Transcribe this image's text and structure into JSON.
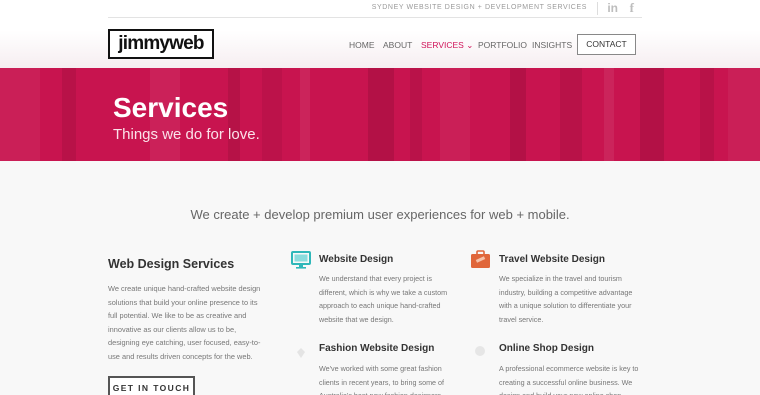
{
  "header": {
    "tagline": "SYDNEY WEBSITE DESIGN + DEVELOPMENT SERVICES",
    "logo_text": "jimmyweb",
    "social": [
      {
        "icon": "linkedin-icon",
        "glyph": "in"
      },
      {
        "icon": "facebook-icon",
        "glyph": "f"
      }
    ],
    "nav": [
      {
        "label": "HOME",
        "active": false
      },
      {
        "label": "ABOUT",
        "active": false
      },
      {
        "label": "SERVICES ⌄",
        "active": true
      },
      {
        "label": "PORTFOLIO",
        "active": false
      },
      {
        "label": "INSIGHTS",
        "active": false
      }
    ],
    "contact_label": "CONTACT"
  },
  "hero": {
    "title": "Services",
    "subtitle": "Things we do for love."
  },
  "main": {
    "intro": "We create + develop premium user experiences for web + mobile.",
    "web_design": {
      "title": "Web Design Services",
      "text": "We create unique hand-crafted website design solutions that build your online presence to its full potential. We like to be as creative and innovative as our clients allow us to be, designing eye catching, user focused, easy-to-use and results driven concepts for the web.",
      "button": "GET IN TOUCH"
    },
    "services": [
      {
        "icon": "monitor-icon",
        "title": "Website Design",
        "text": "We understand that every project is different, which is why we take a custom approach to each unique hand-crafted website that we design."
      },
      {
        "icon": "suitcase-icon",
        "title": "Travel Website Design",
        "text": "We specialize in the travel and tourism industry, building a competitive advantage with a unique solution to differentiate your travel service."
      },
      {
        "icon": "fashion-icon",
        "title": "Fashion Website Design",
        "text": "We've worked with some great fashion clients in recent years, to bring some of Australia's best new fashion designers"
      },
      {
        "icon": "shop-icon",
        "title": "Online Shop Design",
        "text": "A professional ecommerce website is key to creating a successful online business. We design and build your new online shop"
      }
    ]
  },
  "colors": {
    "brand_magenta": "#c8144f",
    "nav_active": "#d0145a",
    "travel_icon": "#e0663a",
    "monitor_icon": "#2fb7b9"
  }
}
